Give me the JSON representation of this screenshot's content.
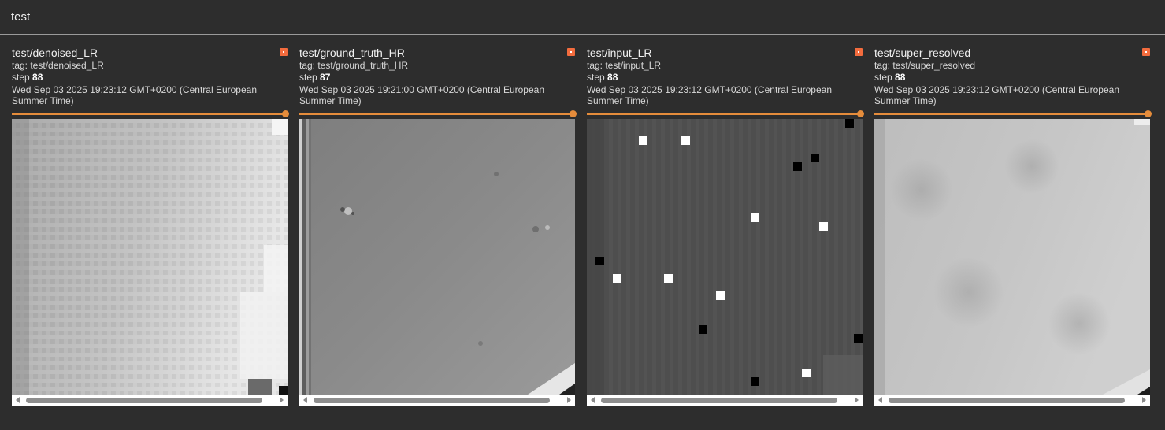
{
  "group": {
    "title": "test"
  },
  "cards": [
    {
      "title": "test/denoised_LR",
      "tag": "tag: test/denoised_LR",
      "step_label": "step",
      "step": "88",
      "time": "Wed Sep 03 2025 19:23:12 GMT+0200 (Central European Summer Time)"
    },
    {
      "title": "test/ground_truth_HR",
      "tag": "tag: test/ground_truth_HR",
      "step_label": "step",
      "step": "87",
      "time": "Wed Sep 03 2025 19:21:00 GMT+0200 (Central European Summer Time)"
    },
    {
      "title": "test/input_LR",
      "tag": "tag: test/input_LR",
      "step_label": "step",
      "step": "88",
      "time": "Wed Sep 03 2025 19:23:12 GMT+0200 (Central European Summer Time)"
    },
    {
      "title": "test/super_resolved",
      "tag": "tag: test/super_resolved",
      "step_label": "step",
      "step": "88",
      "time": "Wed Sep 03 2025 19:23:12 GMT+0200 (Central European Summer Time)"
    }
  ],
  "colors": {
    "accent": "#e58c3b",
    "pin": "#f36c3e",
    "background": "#2d2d2d"
  }
}
